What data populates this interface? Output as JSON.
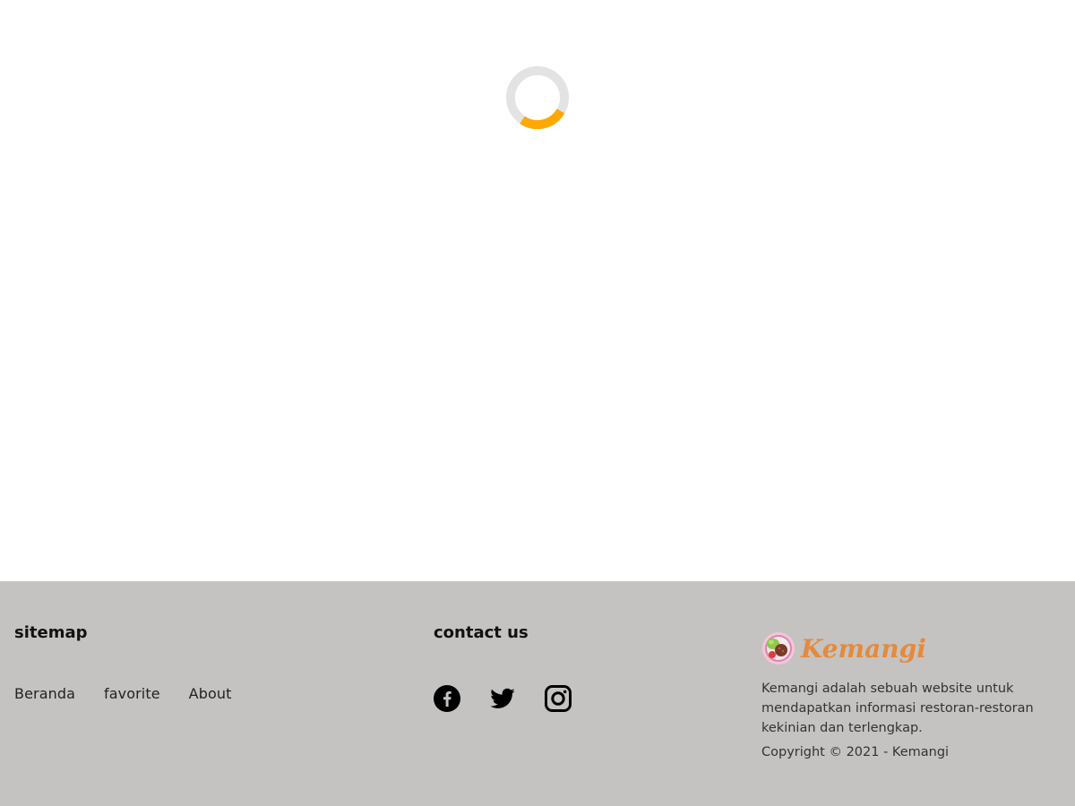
{
  "loader": {
    "track_color": "#e3e3e3",
    "accent_color": "#ffa800",
    "icon": "loading-spinner-icon"
  },
  "footer": {
    "background": "#c4c3c2",
    "sitemap": {
      "title": "sitemap",
      "links": [
        "Beranda",
        "favorite",
        "About"
      ]
    },
    "contact": {
      "title": "contact us",
      "icons": [
        "facebook-icon",
        "twitter-icon",
        "instagram-icon"
      ]
    },
    "brand": {
      "name": "Kemangi",
      "brand_color": "#e58a3c",
      "logo_icon": "food-bowl-logo-icon",
      "description": "Kemangi adalah sebuah website untuk mendapatkan informasi restoran-restoran kekinian dan terlengkap.",
      "copyright": "Copyright © 2021 - Kemangi"
    }
  }
}
